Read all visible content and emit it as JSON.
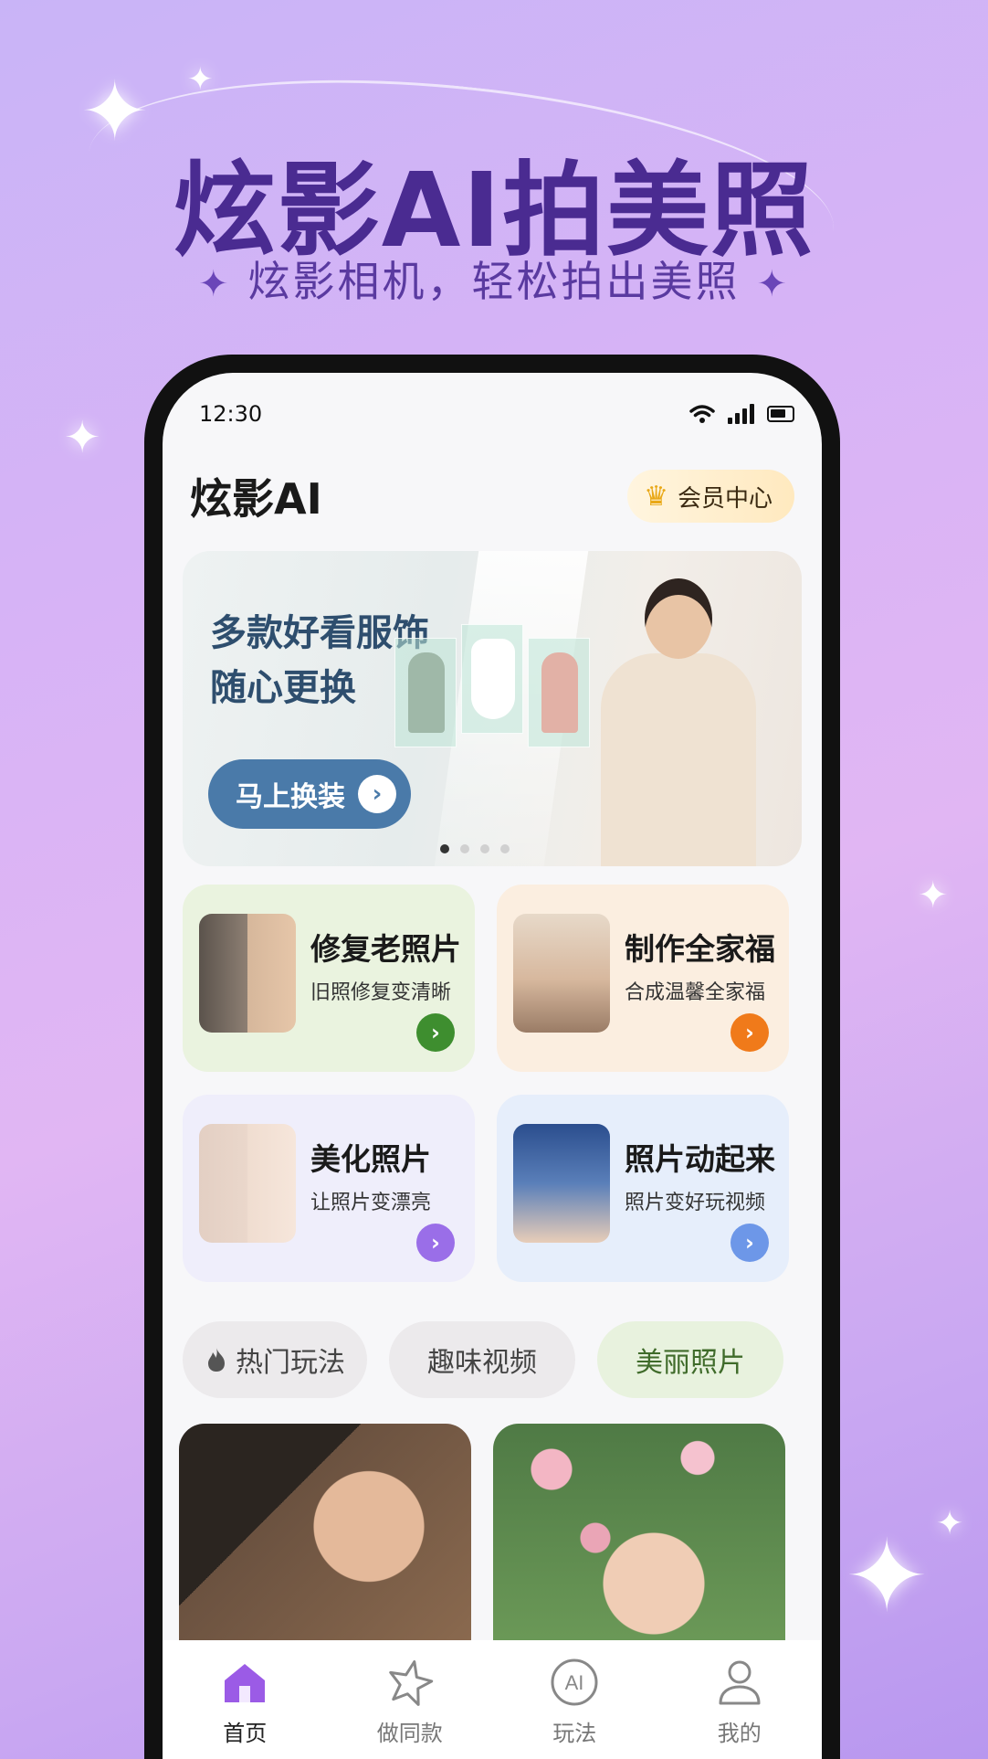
{
  "promo": {
    "headline": "炫影AI拍美照",
    "subline": "炫影相机，轻松拍出美照",
    "star_glyph": "✦"
  },
  "status_bar": {
    "time": "12:30"
  },
  "app": {
    "name": "炫影AI",
    "vip_label": "会员中心",
    "crown_glyph": "♛"
  },
  "banner": {
    "title_line1": "多款好看服饰",
    "title_line2": "随心更换",
    "button_label": "马上换装",
    "chevron": "›",
    "slide_count": 4,
    "active_slide": 1
  },
  "features": [
    {
      "title": "修复老照片",
      "desc": "旧照修复变清晰",
      "bg": "#eaf3df",
      "accent": "#3e8e2f",
      "chevron": "›"
    },
    {
      "title": "制作全家福",
      "desc": "合成温馨全家福",
      "bg": "#fbeee0",
      "accent": "#f07a1a",
      "chevron": "›"
    },
    {
      "title": "美化照片",
      "desc": "让照片变漂亮",
      "bg": "#efeefb",
      "accent": "#9a6ee8",
      "chevron": "›"
    },
    {
      "title": "照片动起来",
      "desc": "照片变好玩视频",
      "bg": "#e6eefb",
      "accent": "#6d97e8",
      "chevron": "›"
    }
  ],
  "tabs": [
    {
      "label": "热门玩法",
      "icon": "flame-icon",
      "active": false
    },
    {
      "label": "趣味视频",
      "active": false
    },
    {
      "label": "美丽照片",
      "active": true
    }
  ],
  "bottom_nav": [
    {
      "label": "首页",
      "icon": "home-icon",
      "active": true
    },
    {
      "label": "做同款",
      "icon": "star-icon",
      "active": false
    },
    {
      "label": "玩法",
      "icon": "ai-icon",
      "ai_text": "AI",
      "active": false
    },
    {
      "label": "我的",
      "icon": "user-icon",
      "active": false
    }
  ],
  "colors": {
    "headline": "#4a2b91",
    "nav_active": "#9b5be6",
    "banner_button": "#4a7aa9"
  }
}
